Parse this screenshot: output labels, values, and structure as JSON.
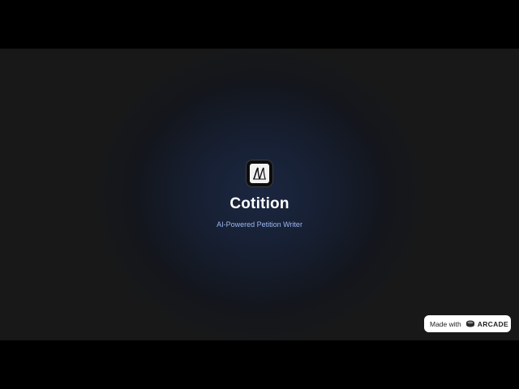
{
  "app": {
    "logo_icon": "cotition-logo-icon",
    "title": "Cotition",
    "subtitle": "AI-Powered Petition Writer"
  },
  "badge": {
    "made_with": "Made with",
    "brand_icon": "arcade-logo-icon",
    "brand": "ARCADE"
  },
  "colors": {
    "subtitle": "#9db7f0",
    "background_center": "#1b2640",
    "background_edge": "#181818"
  }
}
